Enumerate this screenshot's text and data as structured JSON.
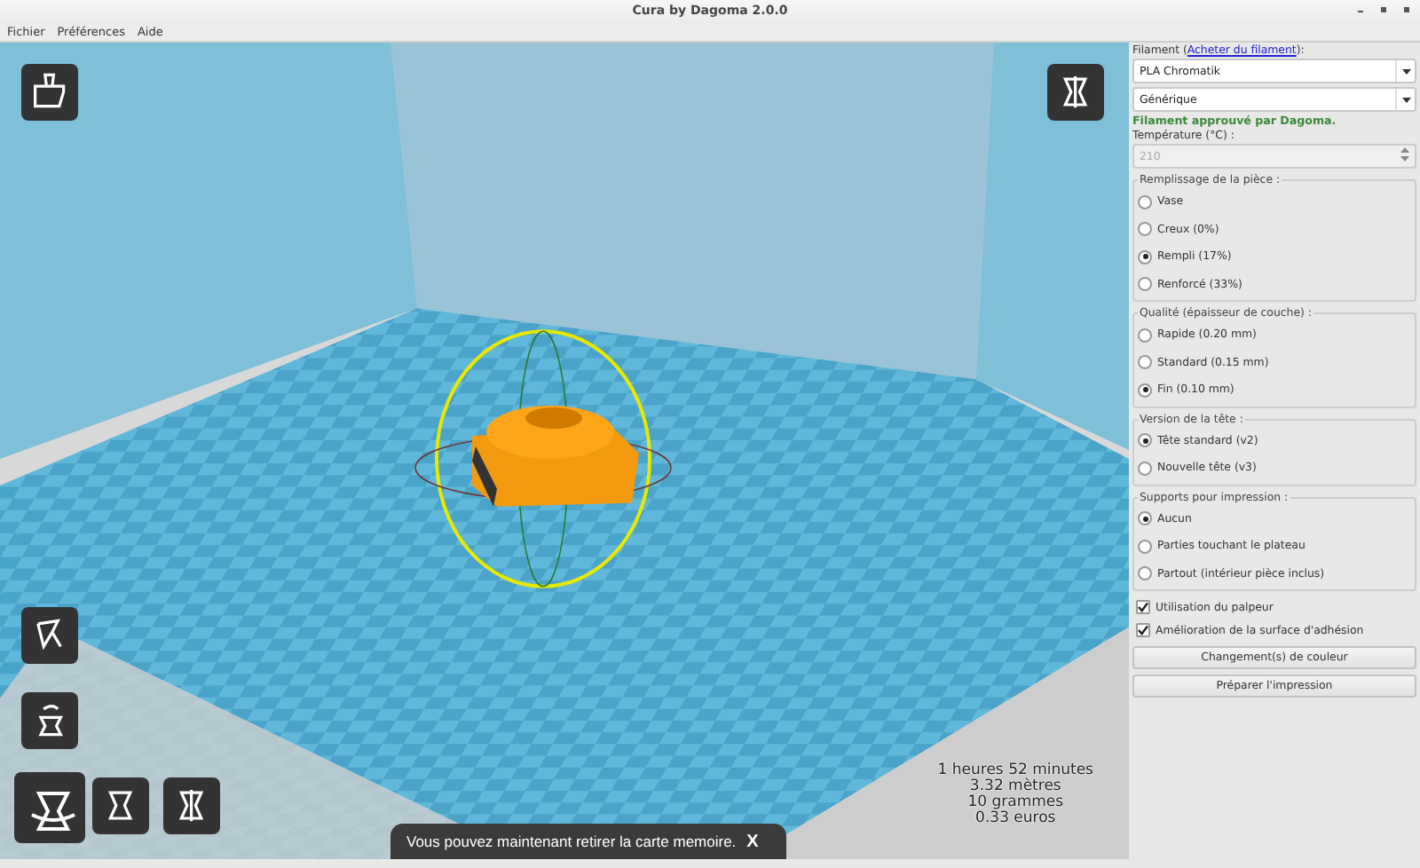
{
  "window": {
    "title": "Cura by Dagoma 2.0.0"
  },
  "menu": [
    "Fichier",
    "Préférences",
    "Aide"
  ],
  "viewport": {
    "stats": [
      "1 heures 52 minutes",
      "3.32 mètres",
      "10 grammes",
      "0.33 euros"
    ],
    "toast": {
      "text": "Vous pouvez maintenant retirer la carte memoire.",
      "close": "X"
    }
  },
  "panel": {
    "filament_prefix": "Filament (",
    "filament_link": "Acheter du filament",
    "filament_suffix": "):",
    "filament": "PLA Chromatik",
    "filament_type": "Générique",
    "approval": "Filament approuvé par Dagoma.",
    "temperature_label": "Température (°C) :",
    "temperature": "210",
    "temperature_disabled": true,
    "groups": [
      {
        "title": "Remplissage de la pièce :",
        "options": [
          {
            "label": "Vase",
            "selected": false
          },
          {
            "label": "Creux (0%)",
            "selected": false
          },
          {
            "label": "Rempli (17%)",
            "selected": true
          },
          {
            "label": "Renforcé (33%)",
            "selected": false
          }
        ]
      },
      {
        "title": "Qualité (épaisseur de couche) :",
        "options": [
          {
            "label": "Rapide (0.20 mm)",
            "selected": false
          },
          {
            "label": "Standard (0.15 mm)",
            "selected": false
          },
          {
            "label": "Fin (0.10 mm)",
            "selected": true
          }
        ]
      },
      {
        "title": "Version de la tête :",
        "options": [
          {
            "label": "Tête standard (v2)",
            "selected": true
          },
          {
            "label": "Nouvelle tête (v3)",
            "selected": false
          }
        ]
      },
      {
        "title": "Supports pour impression :",
        "options": [
          {
            "label": "Aucun",
            "selected": true
          },
          {
            "label": "Parties touchant le plateau",
            "selected": false
          },
          {
            "label": "Partout (intérieur pièce inclus)",
            "selected": false
          }
        ]
      }
    ],
    "checks": [
      {
        "label": "Utilisation du palpeur",
        "checked": true
      },
      {
        "label": "Amélioration de la surface d'adhésion",
        "checked": true
      }
    ],
    "buttons": [
      "Changement(s) de couleur",
      "Préparer l'impression"
    ]
  }
}
